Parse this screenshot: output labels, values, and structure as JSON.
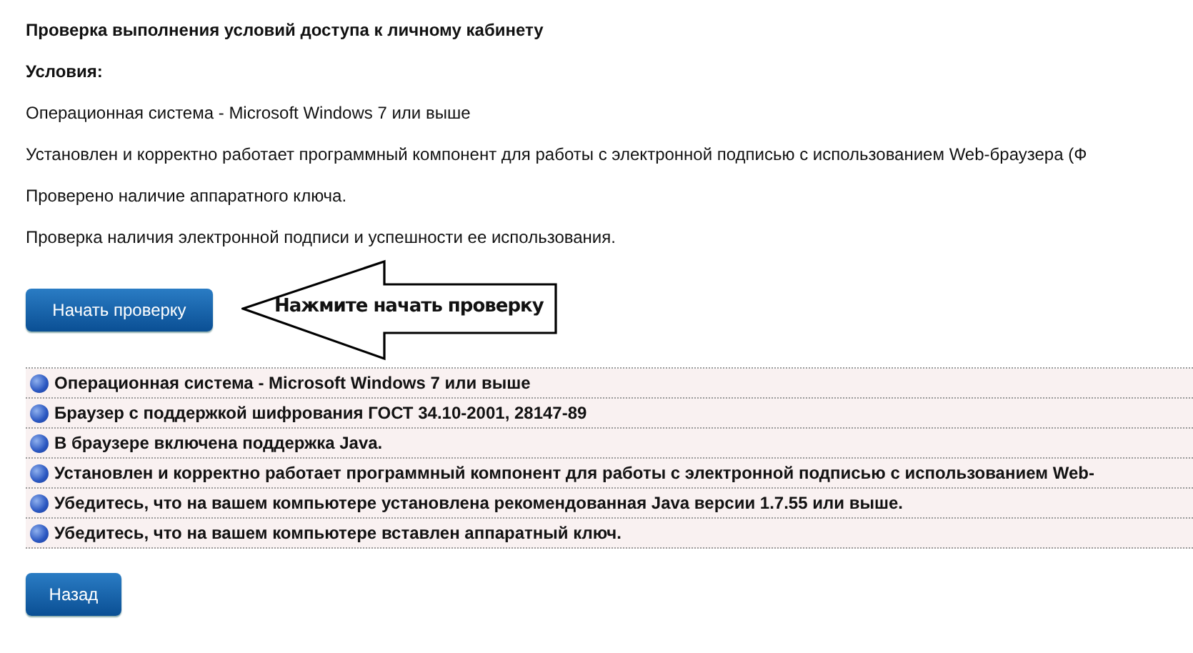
{
  "title": "Проверка выполнения условий доступа к личному кабинету",
  "conditions_label": "Условия:",
  "conditions": [
    "Операционная система - Microsoft Windows 7 или выше",
    "Установлен и корректно работает программный компонент для работы с электронной подписью с использованием Web-браузера (Ф",
    "Проверено наличие аппаратного ключа.",
    "Проверка наличия электронной подписи и успешности ее использования."
  ],
  "start_button": "Начать проверку",
  "hint": "Нажмите начать проверку",
  "checks": [
    "Операционная система - Microsoft Windows 7 или выше",
    "Браузер с поддержкой шифрования ГОСТ 34.10-2001, 28147-89",
    "В браузере включена поддержка Java.",
    "Установлен и корректно работает программный компонент для работы с электронной подписью с использованием Web-",
    "Убедитесь, что на вашем компьютере установлена рекомендованная Java версии 1.7.55 или выше.",
    "Убедитесь, что на вашем компьютере вставлен аппаратный ключ."
  ],
  "back_button": "Назад"
}
